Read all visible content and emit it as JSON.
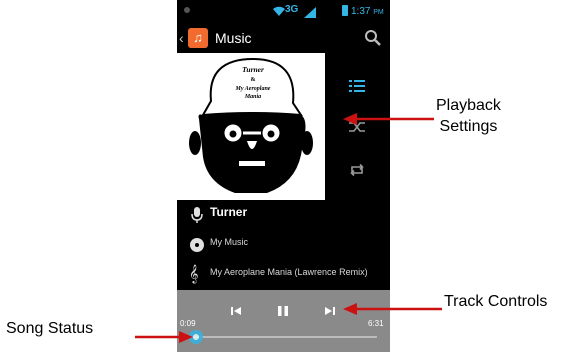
{
  "statusbar": {
    "network": "3G",
    "time": "1:37",
    "ampm": "PM"
  },
  "appbar": {
    "back_glyph": "‹",
    "icon_glyph": "♫",
    "title": "Music"
  },
  "track": {
    "artist": "Turner",
    "album": "My Music",
    "title": "My Aeroplane Mania (Lawrence Remix)",
    "album_art_text": [
      "Turner",
      "&",
      "My Aeroplane",
      "Mania"
    ]
  },
  "player": {
    "elapsed": "0:09",
    "duration": "6:31",
    "progress": 0.03
  },
  "annotations": {
    "playback": [
      "Playback",
      "Settings"
    ],
    "track_controls": "Track Controls",
    "song_status": "Song Status"
  },
  "colors": {
    "accent": "#33b5e5",
    "arrow": "#cc1111",
    "app_icon": "#f26b2e",
    "controls_bg": "#8a8a8a"
  }
}
